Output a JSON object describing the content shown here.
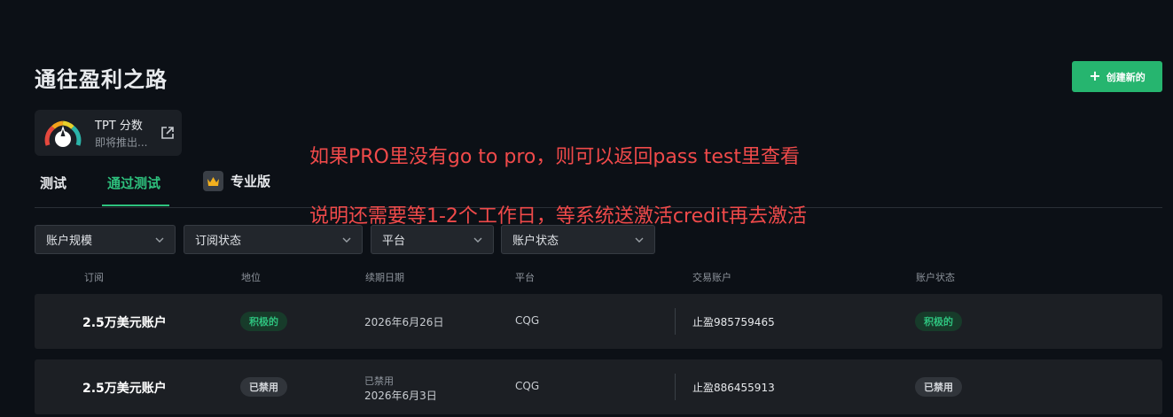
{
  "page": {
    "title": "通往盈利之路",
    "create_button": "创建新的"
  },
  "tpt": {
    "label": "TPT 分数",
    "sub": "即将推出..."
  },
  "tabs": [
    {
      "label": "测试"
    },
    {
      "label": "通过测试"
    },
    {
      "label": "专业版"
    }
  ],
  "annotations": [
    "如果PRO里没有go to pro，则可以返回pass test里查看",
    "说明还需要等1-2个工作日，等系统送激活credit再去激活"
  ],
  "filters": [
    {
      "label": "账户规模"
    },
    {
      "label": "订阅状态"
    },
    {
      "label": "平台"
    },
    {
      "label": "账户状态"
    }
  ],
  "columns": [
    "订阅",
    "地位",
    "续期日期",
    "平台",
    "交易账户",
    "账户状态"
  ],
  "rows": [
    {
      "account": "2.5万美元账户",
      "status": "积极的",
      "renewal_note": "",
      "renewal": "2026年6月26日",
      "platform": "CQG",
      "trading_account": "止盈985759465",
      "account_status": "积极的"
    },
    {
      "account": "2.5万美元账户",
      "status": "已禁用",
      "renewal_note": "已禁用",
      "renewal": "2026年6月3日",
      "platform": "CQG",
      "trading_account": "止盈886455913",
      "account_status": "已禁用"
    }
  ],
  "colors": {
    "background": "#0c1016",
    "accent": "#26b56f",
    "annotation": "#f04a4a"
  }
}
